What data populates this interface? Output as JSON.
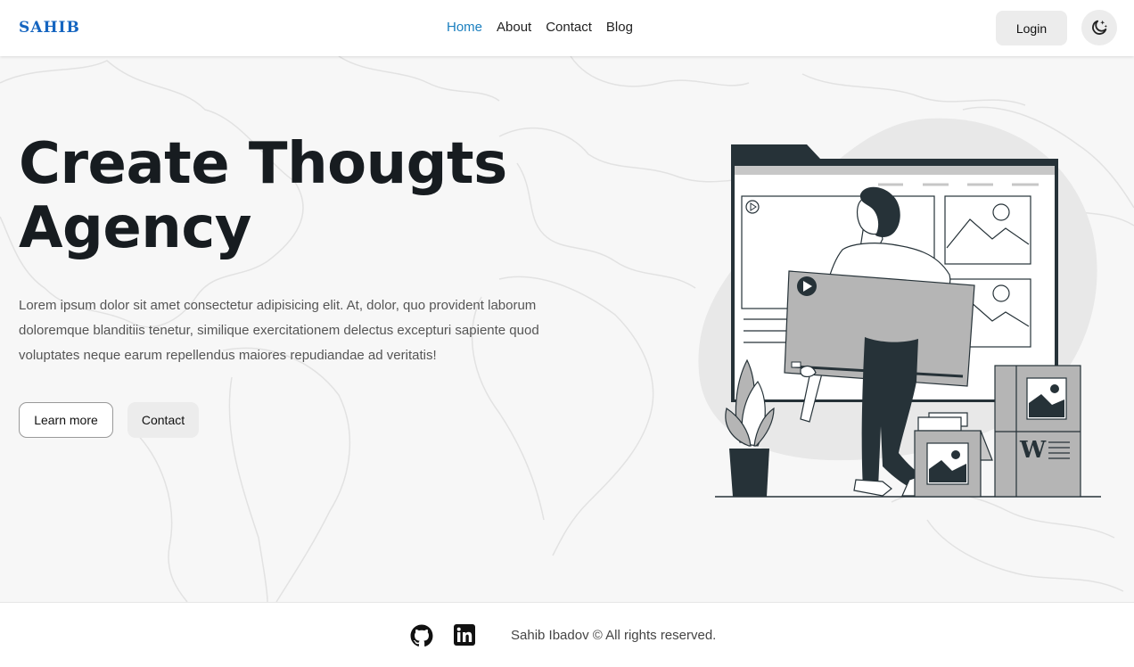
{
  "header": {
    "logo": "SAHIB",
    "nav": [
      {
        "label": "Home",
        "active": true
      },
      {
        "label": "About",
        "active": false
      },
      {
        "label": "Contact",
        "active": false
      },
      {
        "label": "Blog",
        "active": false
      }
    ],
    "login_label": "Login",
    "theme_toggle_icon": "moon-stars-icon"
  },
  "hero": {
    "title_line1": "Create Thougts",
    "title_line2": "Agency",
    "description": "Lorem ipsum dolor sit amet consectetur adipisicing elit. At, dolor, quo provident laborum doloremque blanditiis tenetur, similique exercitationem delectus excepturi sapiente quod voluptates neque earum repellendus maiores repudiandae ad veritatis!",
    "learn_more_label": "Learn more",
    "contact_label": "Contact"
  },
  "footer": {
    "icons": [
      "github-icon",
      "linkedin-icon"
    ],
    "copyright": "Sahib Ibadov © All rights reserved."
  },
  "colors": {
    "brand": "#1565c0",
    "nav_active": "#1a7fbf",
    "dark": "#263238",
    "button_bg": "#ececec"
  }
}
